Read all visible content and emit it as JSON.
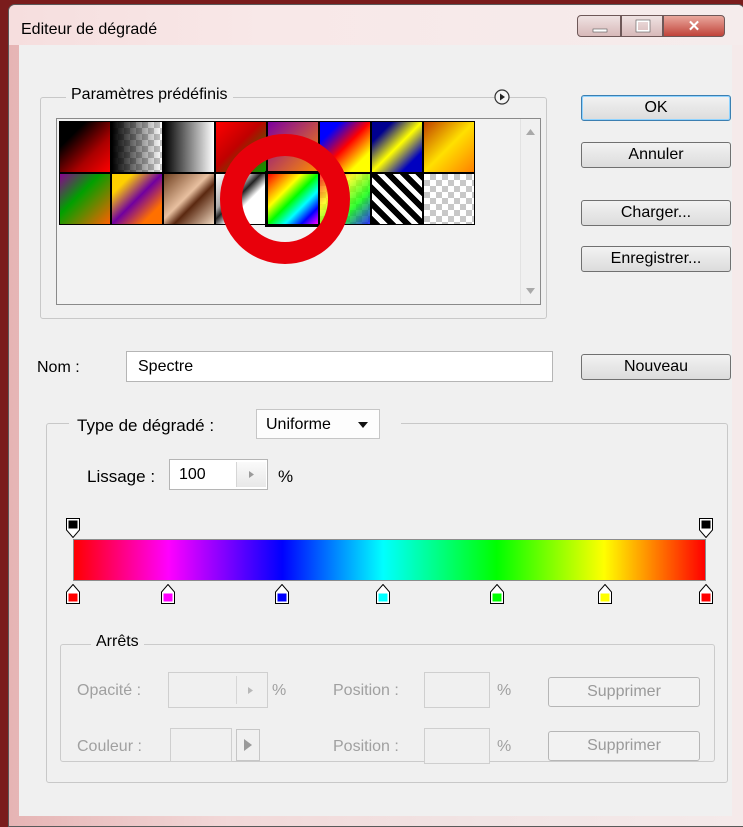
{
  "window": {
    "title": "Editeur de dégradé"
  },
  "presets": {
    "legend": "Paramètres prédéfinis",
    "menu_icon": "circle-arrow-right-icon",
    "selected_index": 12,
    "swatch_names": [
      "foreground-to-background",
      "foreground-to-transparent",
      "black-white",
      "red-green",
      "violet-orange",
      "blue-red-yellow",
      "blue-yellow-blue",
      "copper",
      "chrome",
      "spectrum",
      "transparent-rainbow",
      "transparent-stripes",
      "yellow-violet-orange-blue",
      "orange-yellow-orange",
      "violet-green-orange",
      "transparent-checker"
    ]
  },
  "buttons": {
    "ok": "OK",
    "cancel": "Annuler",
    "load": "Charger...",
    "save": "Enregistrer...",
    "new": "Nouveau"
  },
  "name": {
    "label": "Nom :",
    "value": "Spectre"
  },
  "gradient": {
    "type_label": "Type de dégradé :",
    "type_value": "Uniforme",
    "smoothness_label": "Lissage :",
    "smoothness_value": "100",
    "smoothness_unit": "%",
    "opacity_stops": [
      {
        "position": 0,
        "color": "#000000"
      },
      {
        "position": 100,
        "color": "#000000"
      }
    ],
    "color_stops": [
      {
        "position": 0,
        "color": "#ff0000"
      },
      {
        "position": 15,
        "color": "#ff00ff"
      },
      {
        "position": 33,
        "color": "#0000ff"
      },
      {
        "position": 49,
        "color": "#00ffff"
      },
      {
        "position": 67,
        "color": "#00ff00"
      },
      {
        "position": 84,
        "color": "#ffff00"
      },
      {
        "position": 100,
        "color": "#ff0000"
      }
    ]
  },
  "stops": {
    "legend": "Arrêts",
    "opacity_label": "Opacité :",
    "opacity_unit": "%",
    "color_label": "Couleur :",
    "position_label_1": "Position :",
    "position_unit_1": "%",
    "position_label_2": "Position :",
    "position_unit_2": "%",
    "delete_1": "Supprimer",
    "delete_2": "Supprimer"
  },
  "colors": {
    "highlight_ring": "#e8000b"
  }
}
